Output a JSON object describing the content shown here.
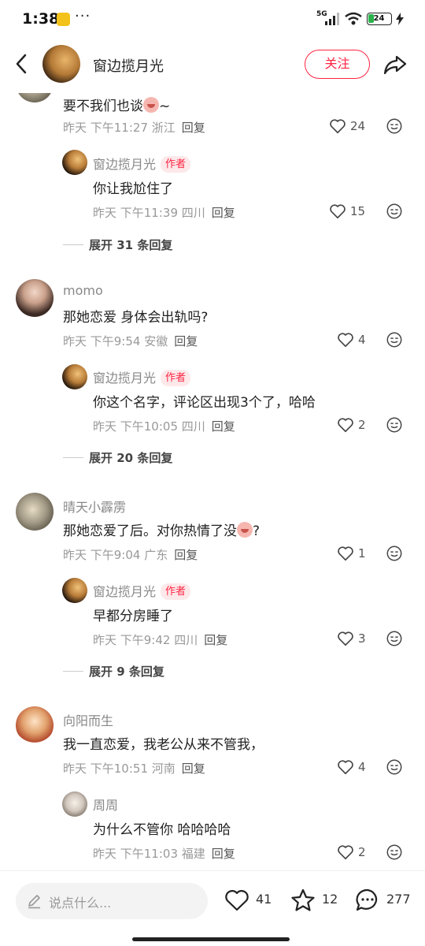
{
  "status_bar": {
    "time": "1:38",
    "dots": "···",
    "network": "5G",
    "battery": "24"
  },
  "header": {
    "name": "窗边揽月光",
    "follow_label": "关注"
  },
  "comments": [
    {
      "text": "要不我们也谈",
      "text_tail": "~",
      "meta": "昨天 下午11:27 浙江",
      "reply_label": "回复",
      "likes": "24",
      "replies": [
        {
          "name": "窗边揽月光",
          "tag": "作者",
          "text": "你让我尬住了",
          "meta": "昨天 下午11:39 四川",
          "reply_label": "回复",
          "likes": "15"
        }
      ],
      "expand": "展开 31 条回复"
    },
    {
      "name": "momo",
      "text": "那她恋爱 身体会出轨吗?",
      "meta": "昨天 下午9:54 安徽",
      "reply_label": "回复",
      "likes": "4",
      "replies": [
        {
          "name": "窗边揽月光",
          "tag": "作者",
          "text": "你这个名字，评论区出现3个了，哈哈",
          "meta": "昨天 下午10:05 四川",
          "reply_label": "回复",
          "likes": "2"
        }
      ],
      "expand": "展开 20 条回复"
    },
    {
      "name": "晴天小霹雳",
      "text": "那她恋爱了后。对你热情了没",
      "text_tail": "?",
      "meta": "昨天 下午9:04 广东",
      "reply_label": "回复",
      "likes": "1",
      "replies": [
        {
          "name": "窗边揽月光",
          "tag": "作者",
          "text": "早都分房睡了",
          "meta": "昨天 下午9:42 四川",
          "reply_label": "回复",
          "likes": "3"
        }
      ],
      "expand": "展开 9 条回复"
    },
    {
      "name": "向阳而生",
      "text": "我一直恋爱，我老公从来不管我，",
      "meta": "昨天 下午10:51 河南",
      "reply_label": "回复",
      "likes": "4",
      "replies": [
        {
          "name": "周周",
          "text": "为什么不管你 哈哈哈哈",
          "meta": "昨天 下午11:03 福建",
          "reply_label": "回复",
          "likes": "2"
        }
      ]
    }
  ],
  "bottom_bar": {
    "placeholder": "说点什么...",
    "likes": "41",
    "stars": "12",
    "comments": "277"
  },
  "colors": {
    "accent": "#ff2442",
    "meta_gray": "#999999"
  }
}
